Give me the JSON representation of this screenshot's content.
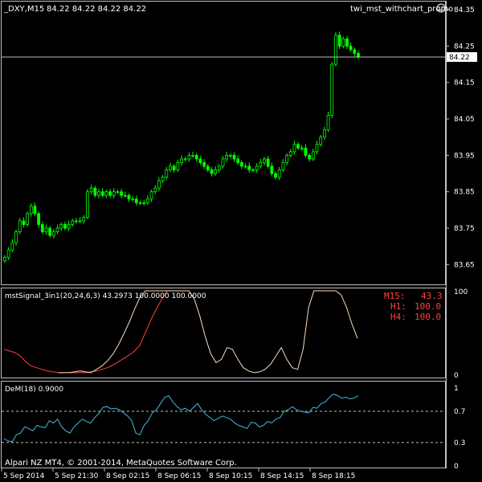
{
  "window": {
    "symbol_label": "_DXY,M15",
    "ohlc": "84.22 84.22 84.22 84.22",
    "ea_label": "twi_mst_withchart_promo",
    "copyright": "Alpari NZ MT4, © 2001-2014, MetaQuotes Software Corp."
  },
  "colors": {
    "background": "#000000",
    "candle": "#00ff00",
    "grid": "#c0c0c0",
    "signal_m15": "#ff4040",
    "signal_long": "#ffdab9",
    "dem": "#48b6d8",
    "current_price_line": "#c0c0c0"
  },
  "indicators": {
    "signal": {
      "label": "mstSignal_3in1(20,24,6,3) 43.2973 100.0000 100.0000",
      "rows": [
        {
          "tf": "M15:",
          "value": "43.3"
        },
        {
          "tf": "H1:",
          "value": "100.0"
        },
        {
          "tf": "H4:",
          "value": "100.0"
        }
      ]
    },
    "dem": {
      "label": "DeM(18) 0.9000"
    }
  },
  "chart_data": [
    {
      "type": "candlestick",
      "title": "_DXY,M15",
      "ylim": [
        83.6,
        84.37
      ],
      "y_ticks": [
        "84.35",
        "84.25",
        "84.15",
        "84.05",
        "83.95",
        "83.85",
        "83.75",
        "83.65"
      ],
      "current_price": 84.22,
      "current_price_label": "84.22",
      "x_ticks": [
        "5 Sep 2014",
        "5 Sep 21:30",
        "8 Sep 02:15",
        "8 Sep 06:15",
        "8 Sep 10:15",
        "8 Sep 14:15",
        "8 Sep 18:15"
      ],
      "close": [
        83.67,
        83.69,
        83.71,
        83.74,
        83.77,
        83.76,
        83.79,
        83.81,
        83.79,
        83.76,
        83.74,
        83.75,
        83.73,
        83.74,
        83.75,
        83.76,
        83.75,
        83.76,
        83.77,
        83.77,
        83.77,
        83.78,
        83.85,
        83.86,
        83.84,
        83.85,
        83.84,
        83.85,
        83.84,
        83.85,
        83.85,
        83.84,
        83.84,
        83.83,
        83.83,
        83.82,
        83.82,
        83.82,
        83.83,
        83.85,
        83.86,
        83.88,
        83.89,
        83.91,
        83.92,
        83.91,
        83.93,
        83.94,
        83.94,
        83.95,
        83.95,
        83.94,
        83.93,
        83.92,
        83.91,
        83.9,
        83.91,
        83.92,
        83.94,
        83.95,
        83.95,
        83.94,
        83.93,
        83.92,
        83.92,
        83.91,
        83.91,
        83.92,
        83.93,
        83.94,
        83.92,
        83.9,
        83.89,
        83.91,
        83.93,
        83.95,
        83.96,
        83.98,
        83.97,
        83.97,
        83.95,
        83.94,
        83.96,
        83.98,
        84.0,
        84.02,
        84.06,
        84.2,
        84.28,
        84.25,
        84.27,
        84.25,
        84.24,
        84.23,
        84.22
      ],
      "series": [
        {
          "name": "M15 bars",
          "values": "close"
        }
      ]
    },
    {
      "type": "line",
      "title": "mstSignal_3in1(20,24,6,3)",
      "ylim": [
        0,
        100
      ],
      "y_ticks": [
        "100",
        "0"
      ],
      "series": [
        {
          "name": "M15",
          "values": [
            30,
            28,
            26,
            22,
            15,
            10,
            8,
            6,
            4,
            3,
            2,
            2,
            2,
            2,
            2,
            2,
            3,
            4,
            6,
            8,
            11,
            15,
            19,
            23,
            28,
            35,
            50,
            65,
            78,
            90,
            100,
            100
          ]
        },
        {
          "name": "H1",
          "values": [
            null,
            null,
            null,
            null,
            null,
            null,
            null,
            null,
            null,
            null,
            2,
            2,
            2,
            3,
            4,
            3,
            2,
            6,
            10,
            16,
            24,
            35,
            48,
            62,
            78,
            92,
            100,
            100,
            100,
            100,
            100,
            100,
            100,
            100,
            100,
            90,
            70,
            45,
            25,
            14,
            18,
            32,
            30,
            18,
            8,
            4,
            2,
            3,
            6,
            12,
            22,
            32,
            18,
            8,
            6,
            30,
            80,
            100,
            100,
            100,
            100,
            100,
            95,
            80,
            60,
            43
          ]
        }
      ]
    },
    {
      "type": "line",
      "title": "DeM(18)",
      "ylim": [
        0,
        1.05
      ],
      "y_ticks": [
        "1",
        "0.7",
        "0.3",
        "0"
      ],
      "series": [
        {
          "name": "DeM(18)",
          "values": [
            0.35,
            0.32,
            0.31,
            0.4,
            0.42,
            0.5,
            0.48,
            0.45,
            0.52,
            0.5,
            0.49,
            0.58,
            0.55,
            0.6,
            0.5,
            0.45,
            0.42,
            0.5,
            0.55,
            0.6,
            0.57,
            0.55,
            0.62,
            0.67,
            0.75,
            0.76,
            0.73,
            0.74,
            0.72,
            0.68,
            0.64,
            0.58,
            0.42,
            0.4,
            0.52,
            0.58,
            0.68,
            0.72,
            0.8,
            0.88,
            0.9,
            0.82,
            0.76,
            0.72,
            0.74,
            0.7,
            0.75,
            0.8,
            0.72,
            0.66,
            0.62,
            0.58,
            0.61,
            0.64,
            0.62,
            0.6,
            0.55,
            0.52,
            0.5,
            0.48,
            0.56,
            0.55,
            0.5,
            0.52,
            0.57,
            0.55,
            0.6,
            0.62,
            0.7,
            0.72,
            0.76,
            0.72,
            0.7,
            0.69,
            0.68,
            0.75,
            0.74,
            0.8,
            0.82,
            0.88,
            0.92,
            0.9,
            0.87,
            0.88,
            0.86,
            0.87,
            0.9
          ]
        }
      ]
    }
  ]
}
